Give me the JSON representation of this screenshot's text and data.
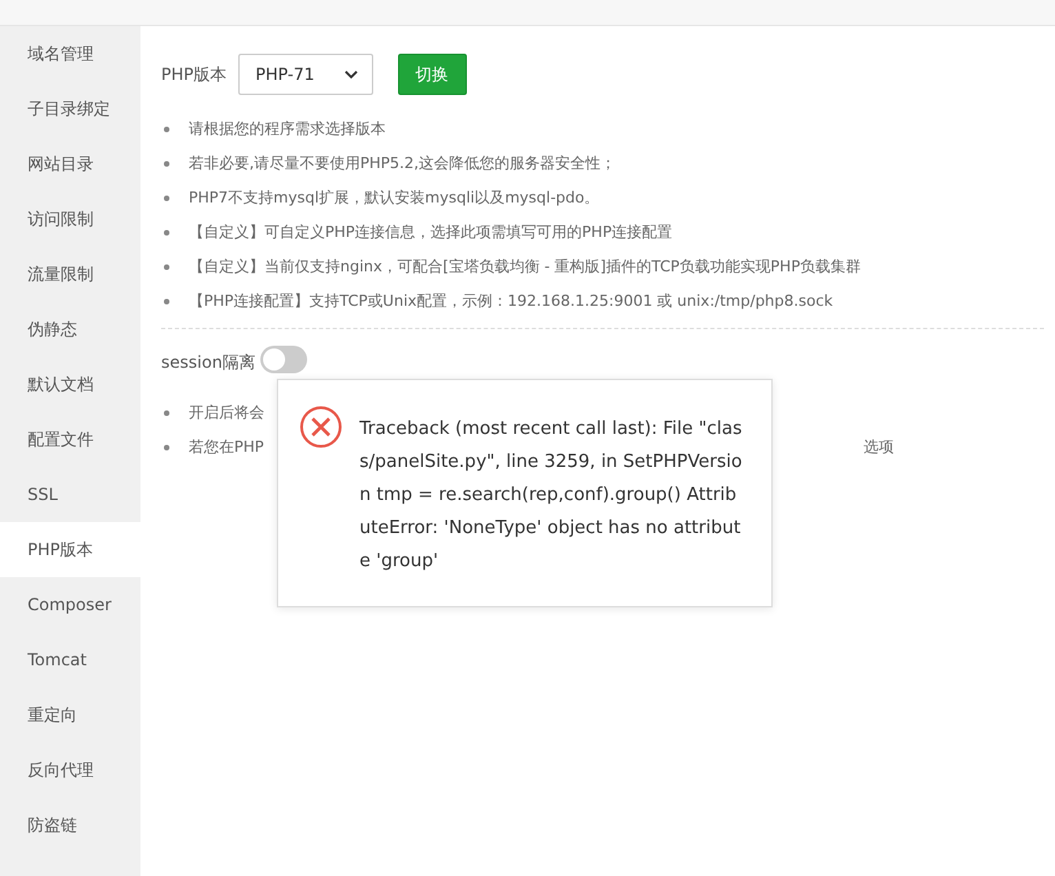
{
  "sidebar": {
    "items": [
      {
        "label": "域名管理",
        "selected": false
      },
      {
        "label": "子目录绑定",
        "selected": false
      },
      {
        "label": "网站目录",
        "selected": false
      },
      {
        "label": "访问限制",
        "selected": false
      },
      {
        "label": "流量限制",
        "selected": false
      },
      {
        "label": "伪静态",
        "selected": false
      },
      {
        "label": "默认文档",
        "selected": false
      },
      {
        "label": "配置文件",
        "selected": false
      },
      {
        "label": "SSL",
        "selected": false
      },
      {
        "label": "PHP版本",
        "selected": true
      },
      {
        "label": "Composer",
        "selected": false
      },
      {
        "label": "Tomcat",
        "selected": false
      },
      {
        "label": "重定向",
        "selected": false
      },
      {
        "label": "反向代理",
        "selected": false
      },
      {
        "label": "防盗链",
        "selected": false
      }
    ]
  },
  "php_version": {
    "label": "PHP版本",
    "value": "PHP-71",
    "button": "切换"
  },
  "notes": [
    "请根据您的程序需求选择版本",
    "若非必要,请尽量不要使用PHP5.2,这会降低您的服务器安全性；",
    "PHP7不支持mysql扩展，默认安装mysqli以及mysql-pdo。",
    "【自定义】可自定义PHP连接信息，选择此项需填写可用的PHP连接配置",
    "【自定义】当前仅支持nginx，可配合[宝塔负载均衡 - 重构版]插件的TCP负载功能实现PHP负载集群",
    "【PHP连接配置】支持TCP或Unix配置，示例：192.168.1.25:9001 或 unix:/tmp/php8.sock"
  ],
  "session": {
    "label": "session隔离",
    "on": false,
    "notes": [
      {
        "start": "开启后将会"
      },
      {
        "start": "若您在PHP",
        "end": "选项"
      }
    ]
  },
  "error_popup": {
    "message": "Traceback (most recent call last): File \"class/panelSite.py\", line 3259, in SetPHPVersion tmp = re.search(rep,conf).group() AttributeError: 'NoneType' object has no attribute 'group'"
  }
}
